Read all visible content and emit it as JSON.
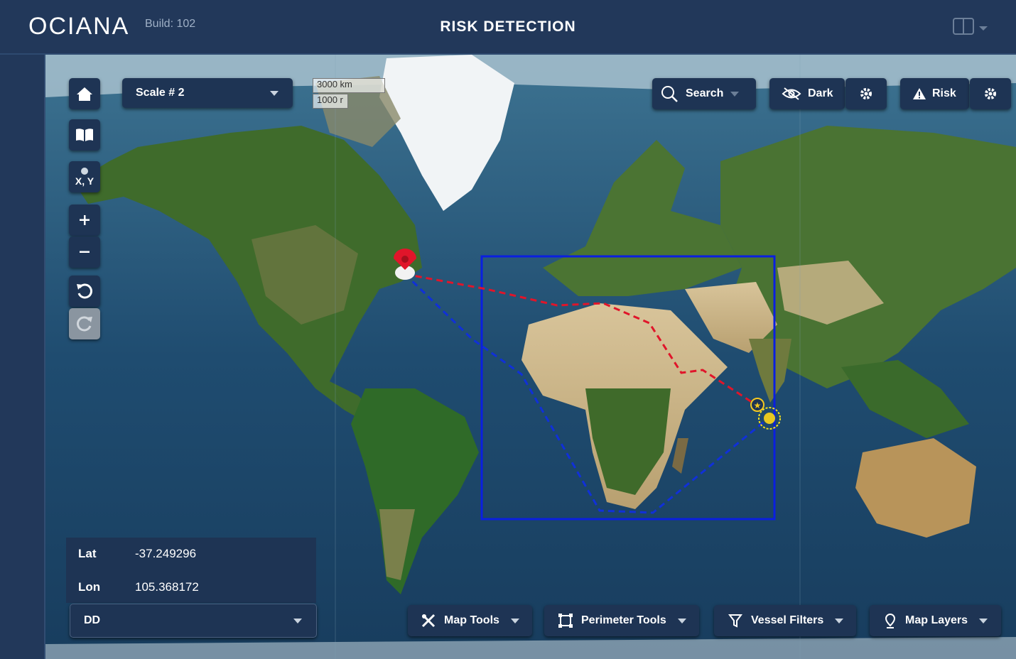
{
  "app": {
    "logo": "OCIANA",
    "build": "Build: 102",
    "title": "RISK DETECTION"
  },
  "toolbar": {
    "scale_label": "Scale # 2",
    "scale_bar_top": "3000 km",
    "scale_bar_bottom": "1000 r",
    "search_label": "Search",
    "dark_label": "Dark",
    "risk_label": "Risk",
    "xy_label": "X, Y"
  },
  "coords": {
    "lat_label": "Lat",
    "lat_value": "-37.249296",
    "lon_label": "Lon",
    "lon_value": "105.368172",
    "format": "DD"
  },
  "bottom_tools": {
    "map_tools": "Map Tools",
    "perimeter_tools": "Perimeter Tools",
    "vessel_filters": "Vessel Filters",
    "map_layers": "Map Layers"
  },
  "icons": [
    "home-icon",
    "book-icon",
    "xy-icon",
    "zoom-in-icon",
    "zoom-out-icon",
    "undo-icon",
    "redo-icon",
    "search-icon",
    "eye-off-icon",
    "gear-icon",
    "warning-icon",
    "wrench-icon",
    "perimeter-icon",
    "filter-icon",
    "pin-icon",
    "layout-icon"
  ],
  "colors": {
    "header_bg": "#22385a",
    "button_bg": "#1e3454",
    "perimeter": "#0a1fe0",
    "route_red": "#e0152a",
    "route_blue": "#1030d8",
    "ocean": "#1e4a6e",
    "land": "#3d6a2c"
  }
}
